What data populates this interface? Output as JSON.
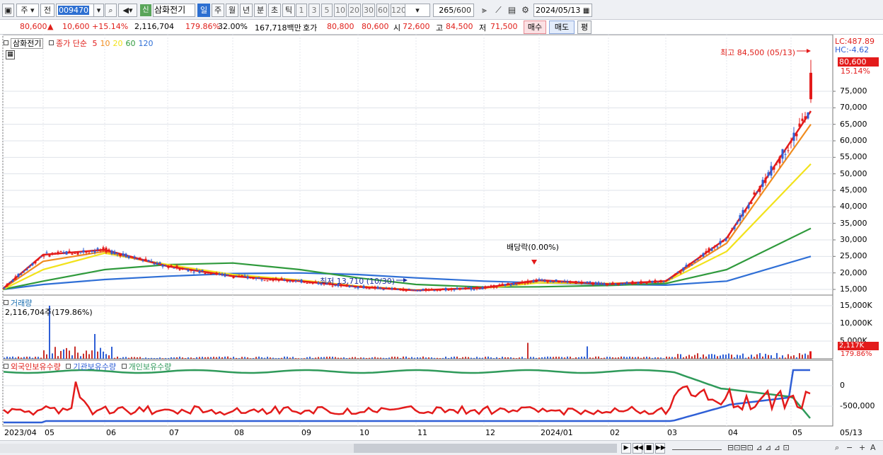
{
  "toolbar": {
    "period_label": "주",
    "prefix_label": "전",
    "code_value": "009470",
    "new_badge": "신",
    "stock_name": "삼화전기",
    "periods": [
      "일",
      "주",
      "월",
      "년",
      "분",
      "초",
      "틱"
    ],
    "selected_period": "일",
    "intervals": [
      "1",
      "3",
      "5",
      "10",
      "20",
      "30",
      "60",
      "120"
    ],
    "count_value": "265",
    "count_total": "/600",
    "date_value": "2024/05/13"
  },
  "quote": {
    "price": "80,600",
    "change_arrow": "▲",
    "change": "10,600",
    "change_pct": "+15.14%",
    "volume": "2,116,704",
    "volume_ratio": "179.86%",
    "turnover": "32.00%",
    "amount": "167,718백만",
    "ask_label": "호가",
    "ask": "80,800",
    "bid": "80,600",
    "open_label": "시",
    "open": "72,600",
    "high_label": "고",
    "high": "84,500",
    "low_label": "저",
    "low": "71,500",
    "buy_button": "매수",
    "sell_button": "매도",
    "avg_button": "평"
  },
  "price_panel": {
    "legend_name": "삼화전기",
    "legend_ma_prefix": "종가 단순",
    "ma_periods": [
      {
        "label": "5",
        "color": "#e31b1b"
      },
      {
        "label": "10",
        "color": "#f08c1e"
      },
      {
        "label": "20",
        "color": "#f2e21b"
      },
      {
        "label": "60",
        "color": "#2f9a3c"
      },
      {
        "label": "120",
        "color": "#2f6fd6"
      }
    ],
    "lc_label": "LC:487.89",
    "hc_label": "HC:-4.62",
    "current_price_tag": "80,600",
    "current_pct_tag": "15.14%",
    "high_annotation": "최고 84,500 (05/13)",
    "low_annotation": "최저 13,710 (10/30)",
    "event_annotation": "배당락(0.00%)",
    "y_ticks": [
      "75,000",
      "70,000",
      "65,000",
      "60,000",
      "55,000",
      "50,000",
      "45,000",
      "40,000",
      "35,000",
      "30,000",
      "25,000",
      "20,000",
      "15,000"
    ]
  },
  "volume_panel": {
    "legend_name": "거래량",
    "value_label": "2,116,704주(179.86%)",
    "y_ticks": [
      "15,000K",
      "10,000K",
      "5,000K"
    ],
    "tag_value": "2,117K",
    "tag_pct": "179.86%"
  },
  "holdings_panel": {
    "legend_foreign": "외국인보유수량",
    "legend_inst": "기관보유수량",
    "legend_indiv": "개인보유수량",
    "colors": {
      "foreign": "#e31b1b",
      "inst": "#2f5fd6",
      "indiv": "#2f9a5a"
    },
    "y_ticks": [
      "0",
      "-500,000"
    ]
  },
  "x_axis": {
    "labels": [
      "2023/04",
      "05",
      "06",
      "07",
      "08",
      "09",
      "10",
      "11",
      "12",
      "2024/01",
      "02",
      "03",
      "04",
      "05"
    ],
    "right_label": "05/13"
  },
  "chart_data": {
    "type": "line",
    "series": [
      {
        "name": "5",
        "x": [
          "2023/04",
          "05",
          "06",
          "07",
          "08",
          "09",
          "10",
          "11",
          "12",
          "2024/01",
          "02",
          "03",
          "04",
          "05/13"
        ],
        "values": [
          15200,
          25500,
          27000,
          22000,
          19000,
          17500,
          15800,
          14700,
          15500,
          17800,
          16600,
          17500,
          30500,
          69000
        ]
      },
      {
        "name": "10",
        "x": [
          "2023/04",
          "05",
          "06",
          "07",
          "08",
          "09",
          "10",
          "11",
          "12",
          "2024/01",
          "02",
          "03",
          "04",
          "05/13"
        ],
        "values": [
          15200,
          23500,
          26500,
          22000,
          19000,
          17500,
          15800,
          14700,
          15500,
          17600,
          16600,
          17500,
          29000,
          65000
        ]
      },
      {
        "name": "20",
        "x": [
          "2023/04",
          "05",
          "06",
          "07",
          "08",
          "09",
          "10",
          "11",
          "12",
          "2024/01",
          "02",
          "03",
          "04",
          "05/13"
        ],
        "values": [
          15000,
          21000,
          26000,
          22500,
          19500,
          17800,
          16000,
          14800,
          15400,
          17000,
          16800,
          17300,
          26500,
          53000
        ]
      },
      {
        "name": "60",
        "x": [
          "2023/04",
          "05",
          "06",
          "07",
          "08",
          "09",
          "10",
          "11",
          "12",
          "2024/01",
          "02",
          "03",
          "04",
          "05/13"
        ],
        "values": [
          15000,
          17500,
          21000,
          22500,
          23000,
          21000,
          18500,
          16500,
          15700,
          15800,
          16200,
          16800,
          21000,
          33500
        ]
      },
      {
        "name": "120",
        "x": [
          "2023/04",
          "05",
          "06",
          "07",
          "08",
          "09",
          "10",
          "11",
          "12",
          "2024/01",
          "02",
          "03",
          "04",
          "05/13"
        ],
        "values": [
          15000,
          16500,
          18000,
          19000,
          19800,
          20000,
          19500,
          18500,
          17500,
          17000,
          16500,
          16300,
          17500,
          25000
        ]
      }
    ],
    "ylim": [
      12000,
      87000
    ]
  }
}
